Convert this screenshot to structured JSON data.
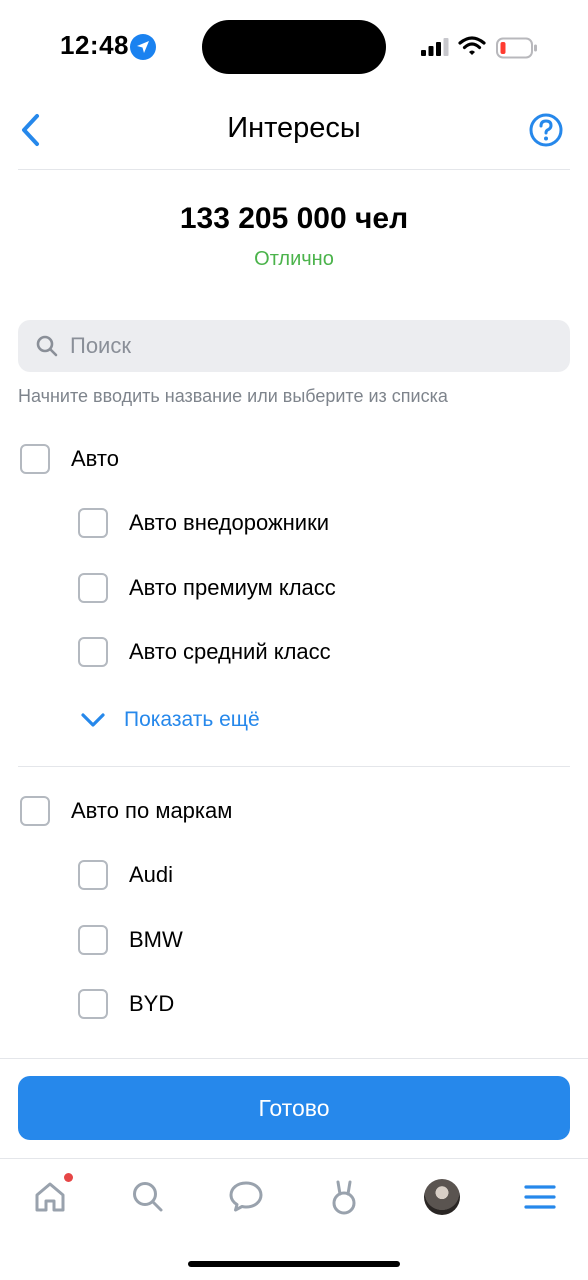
{
  "status_bar": {
    "time": "12:48"
  },
  "header": {
    "title": "Интересы"
  },
  "audience": {
    "count": "133 205 000 чел",
    "status": "Отлично"
  },
  "search": {
    "placeholder": "Поиск",
    "hint": "Начните вводить название или выберите из списка"
  },
  "categories": [
    {
      "label": "Авто",
      "items": [
        "Авто внедорожники",
        "Авто премиум класс",
        "Авто средний класс"
      ],
      "show_more": "Показать ещё"
    },
    {
      "label": "Авто по маркам",
      "items": [
        "Audi",
        "BMW",
        "BYD"
      ]
    }
  ],
  "footer": {
    "done_label": "Готово"
  },
  "tabs": [
    {
      "icon": "home-icon",
      "badge": true
    },
    {
      "icon": "search-icon"
    },
    {
      "icon": "chat-icon"
    },
    {
      "icon": "bunny-icon"
    },
    {
      "icon": "avatar"
    },
    {
      "icon": "menu-icon"
    }
  ],
  "colors": {
    "accent": "#2688eb",
    "success": "#4bb34b",
    "badge": "#e64646"
  }
}
